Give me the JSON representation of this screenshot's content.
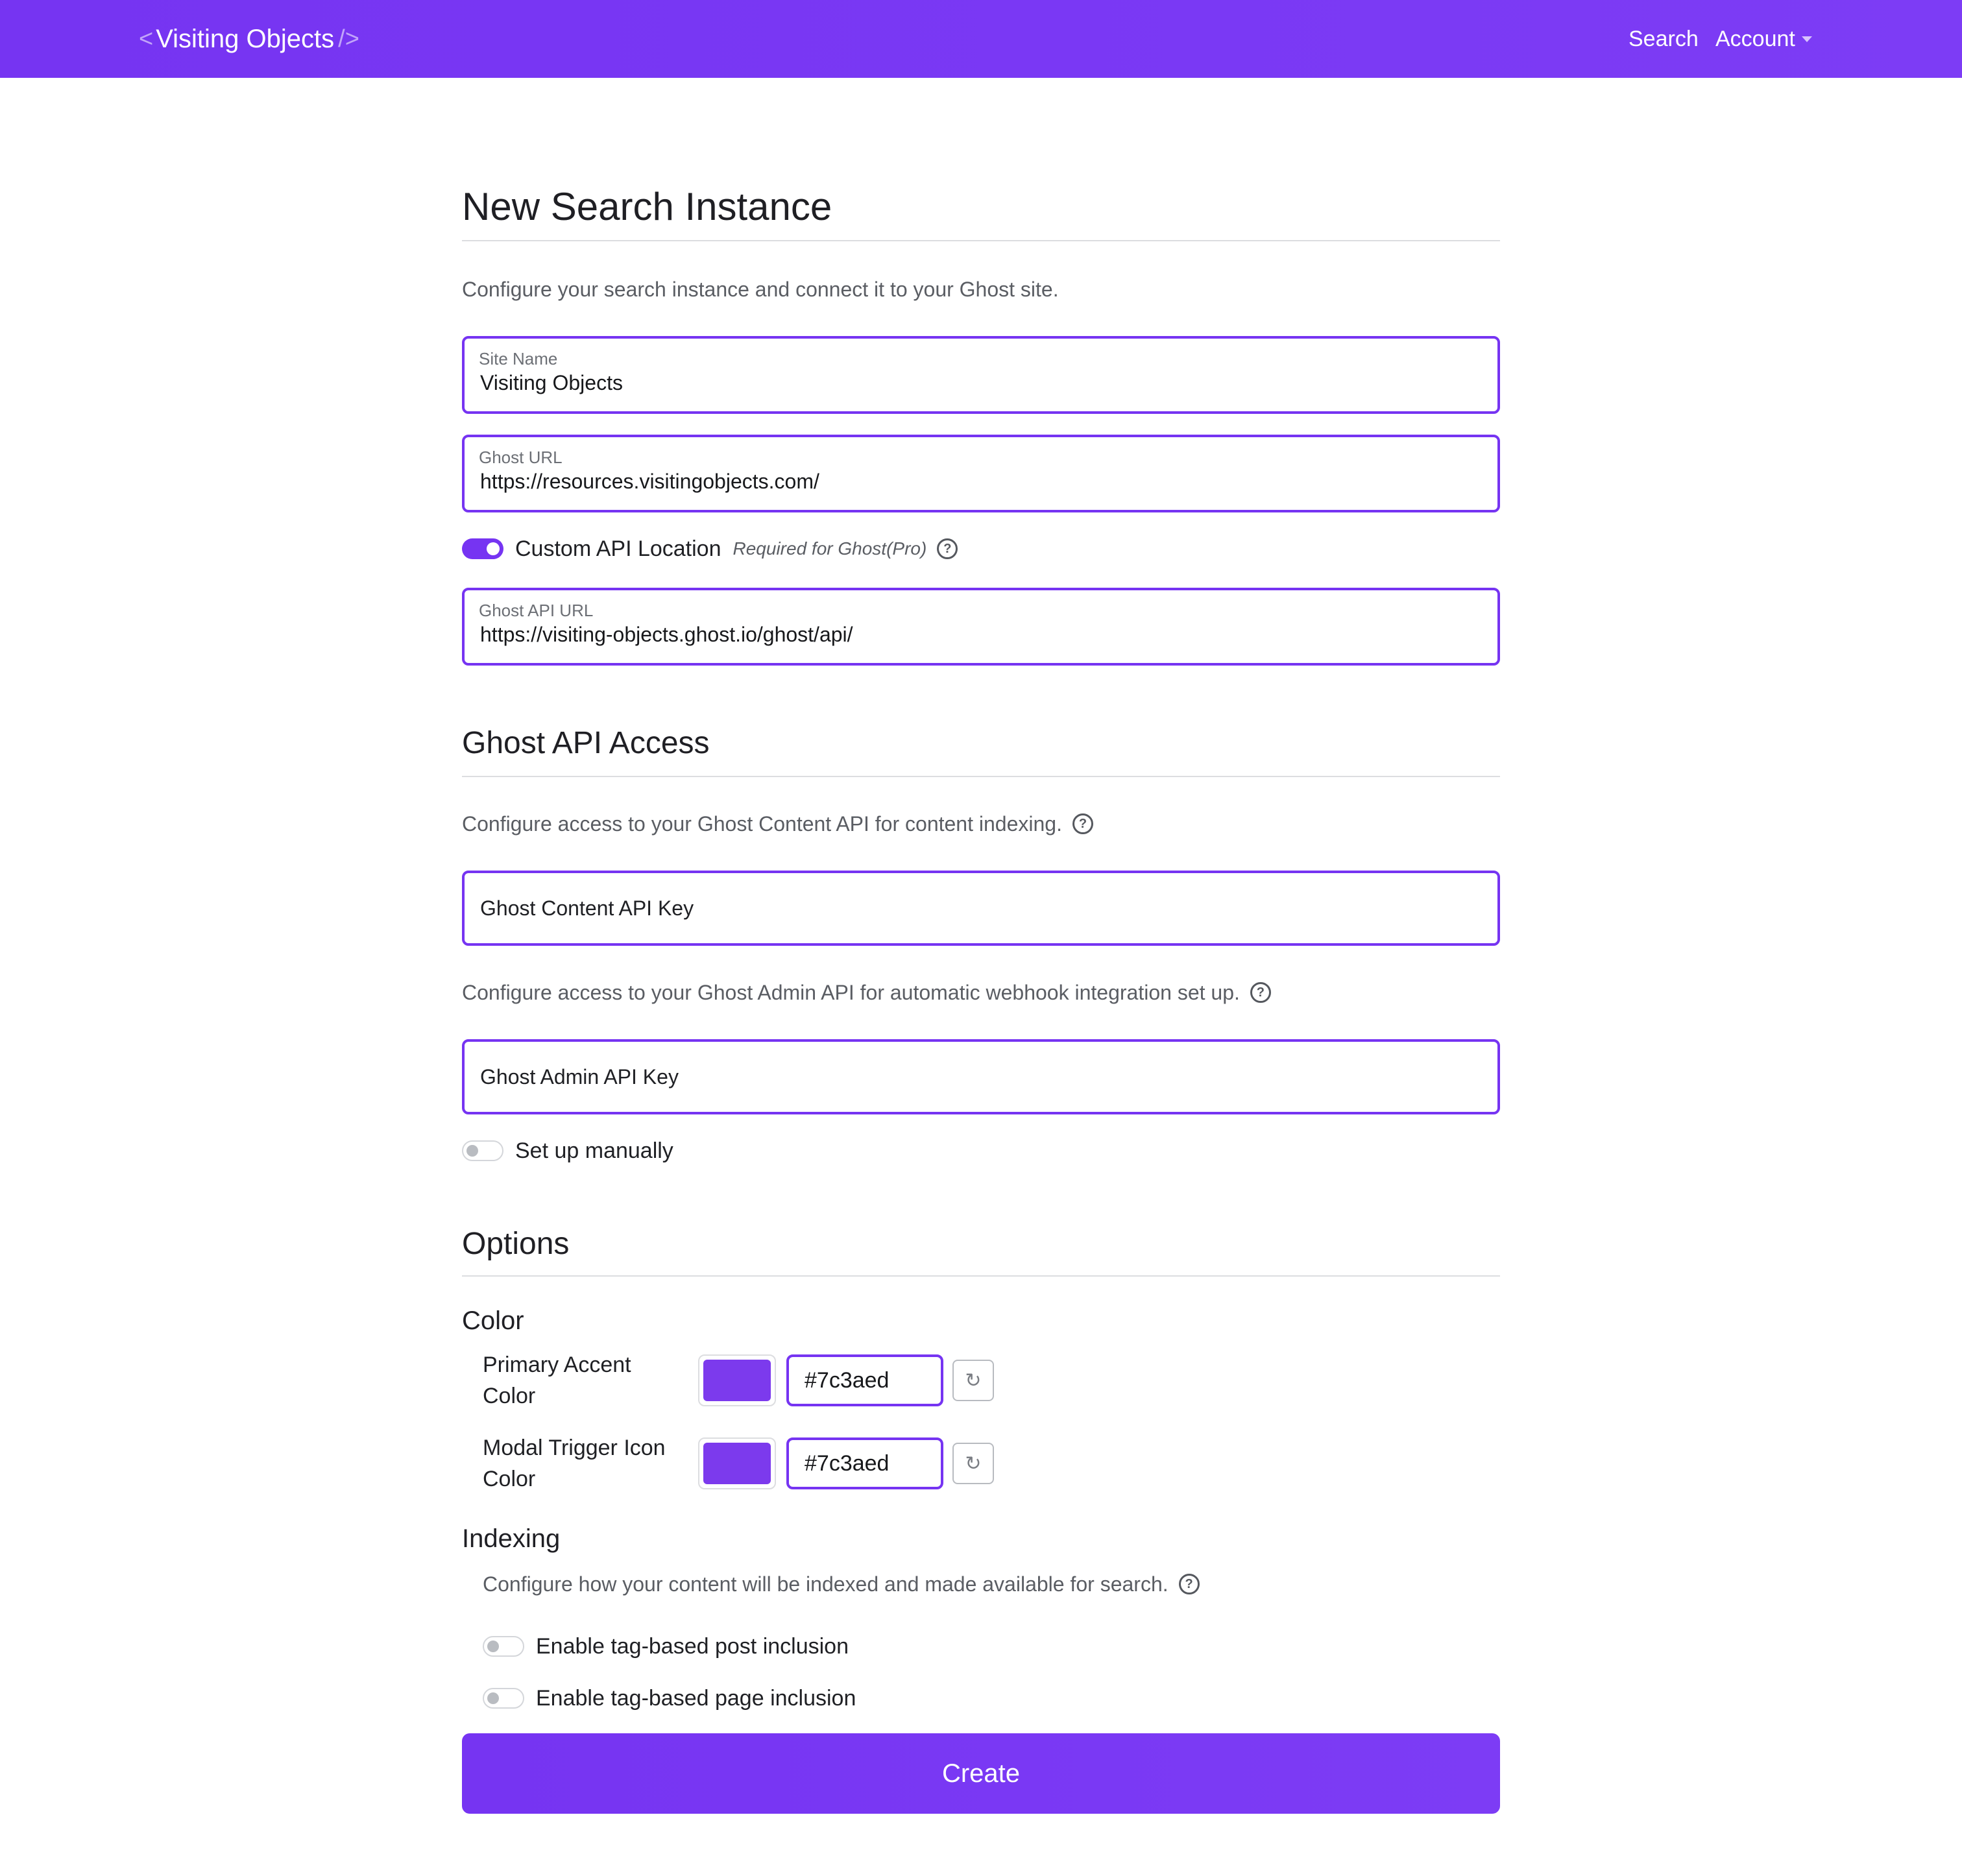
{
  "nav": {
    "brand_open": "<",
    "brand": "Visiting Objects",
    "brand_close": "/>",
    "search_label": "Search",
    "account_label": "Account"
  },
  "instance": {
    "title": "New Search Instance",
    "description": "Configure your search instance and connect it to your Ghost site.",
    "site_name": {
      "label": "Site Name",
      "value": "Visiting Objects"
    },
    "ghost_url": {
      "label": "Ghost URL",
      "value": "https://resources.visitingobjects.com/"
    },
    "custom_api": {
      "label": "Custom API Location",
      "note": "Required for Ghost(Pro)",
      "enabled": true
    },
    "ghost_api_url": {
      "label": "Ghost API URL",
      "value": "https://visiting-objects.ghost.io/ghost/api/"
    }
  },
  "api_access": {
    "title": "Ghost API Access",
    "content_desc": "Configure access to your Ghost Content API for content indexing.",
    "content_key_placeholder": "Ghost Content API Key",
    "admin_desc": "Configure access to your Ghost Admin API for automatic webhook integration set up.",
    "admin_key_placeholder": "Ghost Admin API Key",
    "manual": {
      "label": "Set up manually",
      "enabled": false
    }
  },
  "options": {
    "title": "Options",
    "color": {
      "title": "Color",
      "primary": {
        "label": "Primary Accent Color",
        "value": "#7c3aed"
      },
      "modal": {
        "label": "Modal Trigger Icon Color",
        "value": "#7c3aed"
      }
    },
    "indexing": {
      "title": "Indexing",
      "description": "Configure how your content will be indexed and made available for search.",
      "post_toggle": {
        "label": "Enable tag-based post inclusion",
        "enabled": false
      },
      "page_toggle": {
        "label": "Enable tag-based page inclusion",
        "enabled": false
      }
    }
  },
  "create_label": "Create",
  "icons": {
    "help": "question-circle-icon",
    "reset": "reset-icon",
    "caret": "caret-down-icon"
  },
  "colors": {
    "accent": "#7634f2",
    "swatch": "#7c3aed"
  }
}
